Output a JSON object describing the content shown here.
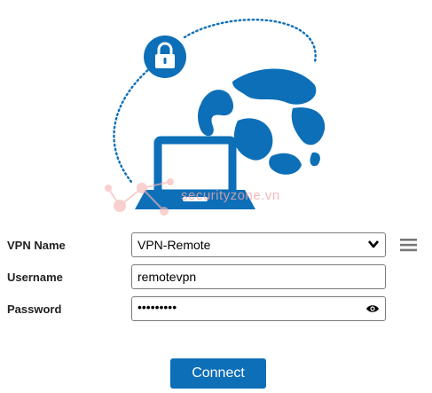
{
  "watermark": {
    "text": "securityzone.vn"
  },
  "form": {
    "vpn_name": {
      "label": "VPN Name",
      "value": "VPN-Remote"
    },
    "username": {
      "label": "Username",
      "value": "remotevpn"
    },
    "password": {
      "label": "Password",
      "masked_value": "•••••••••"
    }
  },
  "actions": {
    "connect_label": "Connect"
  },
  "colors": {
    "accent": "#0d6fb8",
    "watermark": "#f3a8a8"
  },
  "icons": [
    "lock-icon",
    "globe-icon",
    "laptop-icon",
    "chevron-down-icon",
    "menu-icon",
    "eye-icon"
  ]
}
